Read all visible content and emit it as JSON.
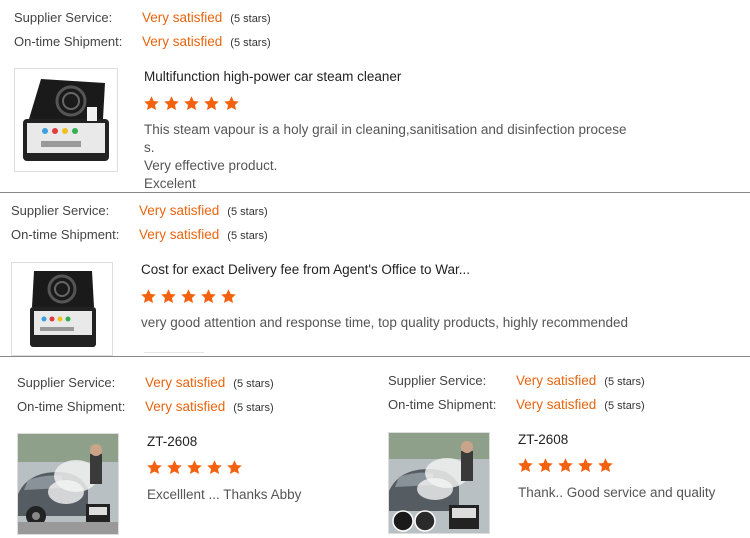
{
  "reviews": [
    {
      "supplier_label": "Supplier Service:",
      "supplier_value": "Very satisfied",
      "supplier_stars": "(5 stars)",
      "shipment_label": "On-time Shipment:",
      "shipment_value": "Very satisfied",
      "shipment_stars": "(5 stars)",
      "product_title": "Multifunction high-power car steam cleaner",
      "rating": 5,
      "text_lines": [
        "This steam vapour is a holy grail in cleaning,sanitisation and disinfection procese",
        "s.",
        "Very effective product.",
        "Excelent"
      ]
    },
    {
      "supplier_label": "Supplier Service:",
      "supplier_value": "Very satisfied",
      "supplier_stars": "(5 stars)",
      "shipment_label": "On-time Shipment:",
      "shipment_value": "Very satisfied",
      "shipment_stars": "(5 stars)",
      "product_title": "Cost for exact Delivery fee from Agent's Office to War...",
      "rating": 5,
      "text_lines": [
        "very good attention and response time, top quality products, highly recommended"
      ]
    },
    {
      "supplier_label": "Supplier Service:",
      "supplier_value": "Very satisfied",
      "supplier_stars": "(5 stars)",
      "shipment_label": "On-time Shipment:",
      "shipment_value": "Very satisfied",
      "shipment_stars": "(5 stars)",
      "product_title": "ZT-2608",
      "rating": 5,
      "text_lines": [
        "Excelllent ... Thanks Abby"
      ]
    },
    {
      "supplier_label": "Supplier Service:",
      "supplier_value": "Very satisfied",
      "supplier_stars": "(5 stars)",
      "shipment_label": "On-time Shipment:",
      "shipment_value": "Very satisfied",
      "shipment_stars": "(5 stars)",
      "product_title": "ZT-2608",
      "rating": 5,
      "text_lines": [
        "Thank.. Good service and quality"
      ]
    }
  ],
  "colors": {
    "accent": "#e8650f",
    "star": "#f5620f",
    "divider": "#888888"
  },
  "icons": {
    "star": "star-icon"
  }
}
